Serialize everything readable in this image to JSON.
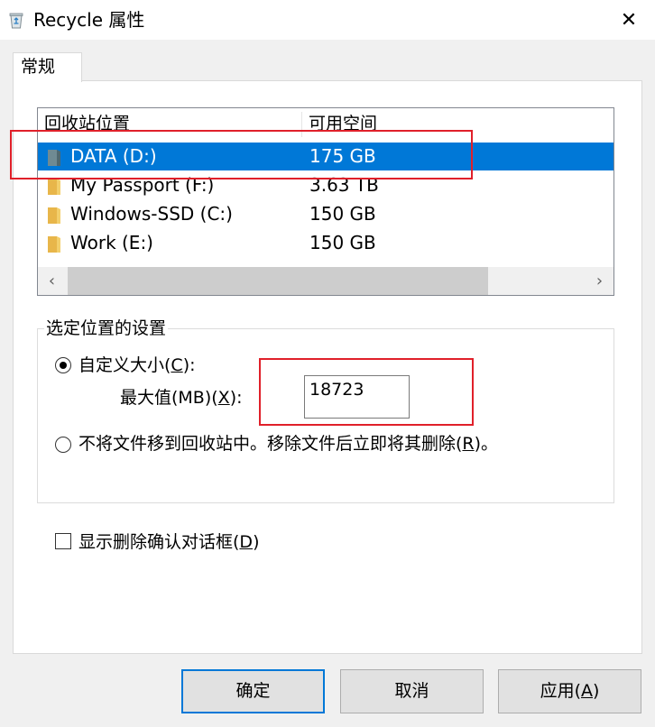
{
  "window": {
    "title": "Recycle  属性",
    "close_glyph": "✕"
  },
  "tabs": [
    {
      "label": "常规"
    }
  ],
  "locations": {
    "headers": {
      "name": "回收站位置",
      "space": "可用空间"
    },
    "rows": [
      {
        "name": "DATA (D:)",
        "space": "175 GB",
        "selected": true
      },
      {
        "name": "My Passport (F:)",
        "space": "3.63 TB",
        "selected": false
      },
      {
        "name": "Windows-SSD (C:)",
        "space": "150 GB",
        "selected": false
      },
      {
        "name": "Work (E:)",
        "space": "150 GB",
        "selected": false
      }
    ],
    "scroll_left_glyph": "‹",
    "scroll_right_glyph": "›"
  },
  "settings": {
    "legend": "选定位置的设置",
    "custom_size": {
      "label_pre": "自定义大小(",
      "mnemonic": "C",
      "label_post": "):",
      "checked": true
    },
    "max_value": {
      "label_pre": "最大值(MB)(",
      "mnemonic": "X",
      "label_post": "):",
      "value": "18723"
    },
    "no_recycle": {
      "label_pre": "不将文件移到回收站中。移除文件后立即将其删除(",
      "mnemonic": "R",
      "label_post": ")。",
      "checked": false
    }
  },
  "confirm_dialog": {
    "label_pre": "显示删除确认对话框(",
    "mnemonic": "D",
    "label_post": ")",
    "checked": false
  },
  "buttons": {
    "ok": "确定",
    "cancel": "取消",
    "apply_pre": "应用(",
    "apply_mnemonic": "A",
    "apply_post": ")"
  },
  "colors": {
    "selection": "#0078d7",
    "annotation": "#e0202a",
    "folder": "#e8b64a",
    "drive": "#6f8a93"
  },
  "icons": {
    "title": "recycle-bin-icon",
    "folder": "folder-icon",
    "drive": "drive-icon"
  }
}
